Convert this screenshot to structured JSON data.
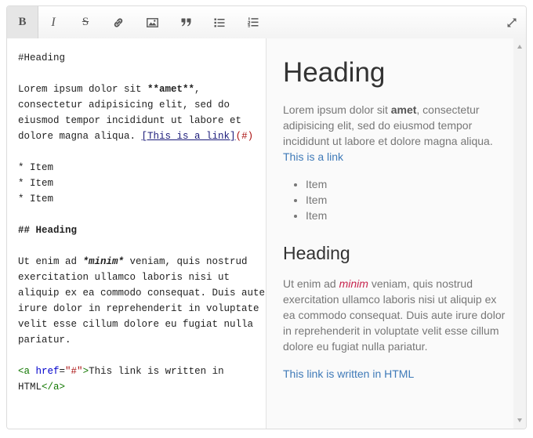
{
  "toolbar": {
    "bold_label": "B",
    "italic_label": "I",
    "strike_label": "S",
    "icons": [
      "bold-icon",
      "italic-icon",
      "strikethrough-icon",
      "link-icon",
      "image-icon",
      "quote-icon",
      "bullet-list-icon",
      "numbered-list-icon",
      "fullscreen-icon"
    ]
  },
  "editor": {
    "h1_line": "#Heading",
    "p1_start": "Lorem ipsum dolor sit ",
    "p1_bold": "**amet**",
    "p1_rest": ",\nconsectetur adipisicing elit, sed do\neiusmod tempor incididunt ut labore et\ndolore magna aliqua. ",
    "p1_link_text": "[This is a link]",
    "p1_link_url": "(#)",
    "list": "* Item\n* Item\n* Item",
    "h2_line": "## Heading",
    "p2_start": "Ut enim ad ",
    "p2_em": "*minim*",
    "p2_rest": " veniam, quis nostrud\nexercitation ullamco laboris nisi ut\naliquip ex ea commodo consequat. Duis aute\nirure dolor in reprehenderit in voluptate\nvelit esse cillum dolore eu fugiat nulla\npariatur.",
    "html_tag_open": "<a ",
    "html_attr": "href",
    "html_eq": "=",
    "html_str": "\"#\"",
    "html_tag_close": ">",
    "html_text": "This link is written in\nHTML",
    "html_end_tag": "</a>"
  },
  "preview": {
    "h1": "Heading",
    "p1_start": "Lorem ipsum dolor sit ",
    "p1_bold": "amet",
    "p1_rest": ", consectetur adipisicing elit, sed do eiusmod tempor incididunt ut labore et dolore magna aliqua. ",
    "p1_link": "This is a link",
    "items": [
      "Item",
      "Item",
      "Item"
    ],
    "h2": "Heading",
    "p2_start": "Ut enim ad ",
    "p2_em": "minim",
    "p2_rest": " veniam, quis nostrud exercitation ullamco laboris nisi ut aliquip ex ea commodo consequat. Duis aute irure dolor in reprehenderit in voluptate velit esse cillum dolore eu fugiat nulla pariatur.",
    "html_link": "This link is written in HTML"
  },
  "colors": {
    "link": "#3f7ab8",
    "emphasis": "#c7254e",
    "preview_text": "#777777",
    "heading": "#333333"
  }
}
